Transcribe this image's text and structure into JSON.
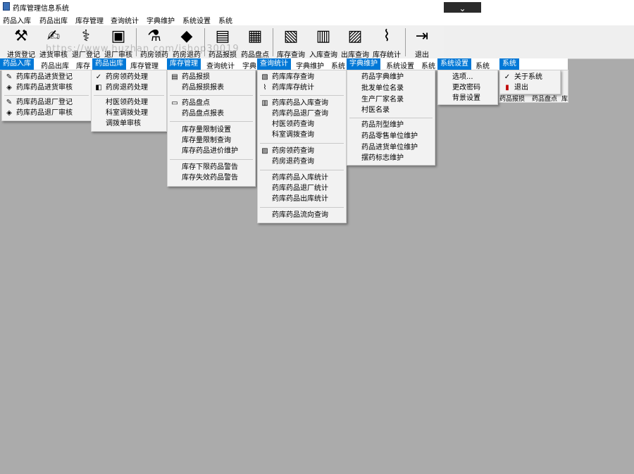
{
  "window": {
    "title": "药库管理信息系统",
    "dropdown_glyph": "⌄"
  },
  "menubar": [
    "药品入库",
    "药品出库",
    "库存管理",
    "查询统计",
    "字典维护",
    "系统设置",
    "系统"
  ],
  "toolbar": {
    "items": [
      {
        "label": "进货登记",
        "icon": "⚒"
      },
      {
        "label": "进货审核",
        "icon": "✍"
      },
      {
        "label": "退厂登记",
        "icon": "⚕"
      },
      {
        "label": "退厂审核",
        "icon": "▣"
      },
      {
        "label": "药房领药",
        "icon": "⚗"
      },
      {
        "label": "药房退药",
        "icon": "◆"
      },
      {
        "label": "药品报损",
        "icon": "▤"
      },
      {
        "label": "药品盘点",
        "icon": "▦"
      },
      {
        "label": "库存查询",
        "icon": "▧"
      },
      {
        "label": "入库查询",
        "icon": "▥"
      },
      {
        "label": "出库查询",
        "icon": "▨"
      },
      {
        "label": "库存统计",
        "icon": "⌇"
      },
      {
        "label": "退出",
        "icon": "⇥"
      }
    ],
    "watermark": "https://www.huzhan.com/ishop30019"
  },
  "strips": {
    "s1": [
      "药品入库",
      "药品出库",
      "库存"
    ],
    "s2": [
      "药品出库",
      "库存管理"
    ],
    "s3": [
      "库存管理",
      "查询统计",
      "字典"
    ],
    "s4": [
      "查询统计",
      "字典维护",
      "系统"
    ],
    "s5": [
      "字典维护",
      "系统设置",
      "系统"
    ],
    "s6": [
      "系统设置",
      "系统"
    ],
    "s7": [
      "系统"
    ]
  },
  "menus": {
    "m1": [
      {
        "label": "药库药品进货登记",
        "icon": "✎"
      },
      {
        "label": "药库药品进货审核",
        "icon": "◈"
      },
      {
        "label": "药库药品退厂登记",
        "icon": "✎"
      },
      {
        "label": "药库药品退厂审核",
        "icon": "◈"
      }
    ],
    "m2": [
      {
        "label": "药房领药处理",
        "icon": "✓"
      },
      {
        "label": "药房退药处理",
        "icon": "◧"
      },
      {
        "label": "村医领药处理",
        "icon": ""
      },
      {
        "label": "科室调拨处理",
        "icon": ""
      },
      {
        "label": "调拨单审核",
        "icon": ""
      }
    ],
    "m3": [
      {
        "label": "药品报损",
        "icon": "▤"
      },
      {
        "label": "药品报损报表",
        "icon": ""
      },
      {
        "label": "药品盘点",
        "icon": "▭"
      },
      {
        "label": "药品盘点报表",
        "icon": ""
      },
      {
        "label": "库存量限制设置",
        "icon": ""
      },
      {
        "label": "库存量限制查询",
        "icon": ""
      },
      {
        "label": "库存药品进价维护",
        "icon": ""
      },
      {
        "label": "库存下限药品警告",
        "icon": ""
      },
      {
        "label": "库存失效药品警告",
        "icon": ""
      }
    ],
    "m4": [
      {
        "label": "药库库存查询",
        "icon": "▧"
      },
      {
        "label": "药库库存统计",
        "icon": "⌇"
      },
      {
        "label": "药库药品入库查询",
        "icon": "▥"
      },
      {
        "label": "药库药品退厂查询",
        "icon": ""
      },
      {
        "label": "村医领药查询",
        "icon": ""
      },
      {
        "label": "科室调拨查询",
        "icon": ""
      },
      {
        "label": "药房领药查询",
        "icon": "▨"
      },
      {
        "label": "药房退药查询",
        "icon": ""
      },
      {
        "label": "药库药品入库统计",
        "icon": ""
      },
      {
        "label": "药库药品退厂统计",
        "icon": ""
      },
      {
        "label": "药库药品出库统计",
        "icon": ""
      },
      {
        "label": "药库药品流向查询",
        "icon": ""
      }
    ],
    "m5": [
      {
        "label": "药品字典维护",
        "icon": ""
      },
      {
        "label": "批发单位名录",
        "icon": ""
      },
      {
        "label": "生产厂家名录",
        "icon": ""
      },
      {
        "label": "村医名录",
        "icon": ""
      },
      {
        "label": "药品剂型维护",
        "icon": ""
      },
      {
        "label": "药品零售单位维护",
        "icon": ""
      },
      {
        "label": "药品进货单位维护",
        "icon": ""
      },
      {
        "label": "摆药标志维护",
        "icon": ""
      }
    ],
    "m6": [
      {
        "label": "选项...",
        "icon": ""
      },
      {
        "label": "更改密码",
        "icon": ""
      },
      {
        "label": "背景设置",
        "icon": ""
      }
    ],
    "m7": [
      {
        "label": "关于系统",
        "icon": "✓"
      },
      {
        "label": "退出",
        "icon": "▮"
      }
    ]
  },
  "mini_toolbar": [
    "药品报损",
    "药品盘点",
    "库"
  ]
}
